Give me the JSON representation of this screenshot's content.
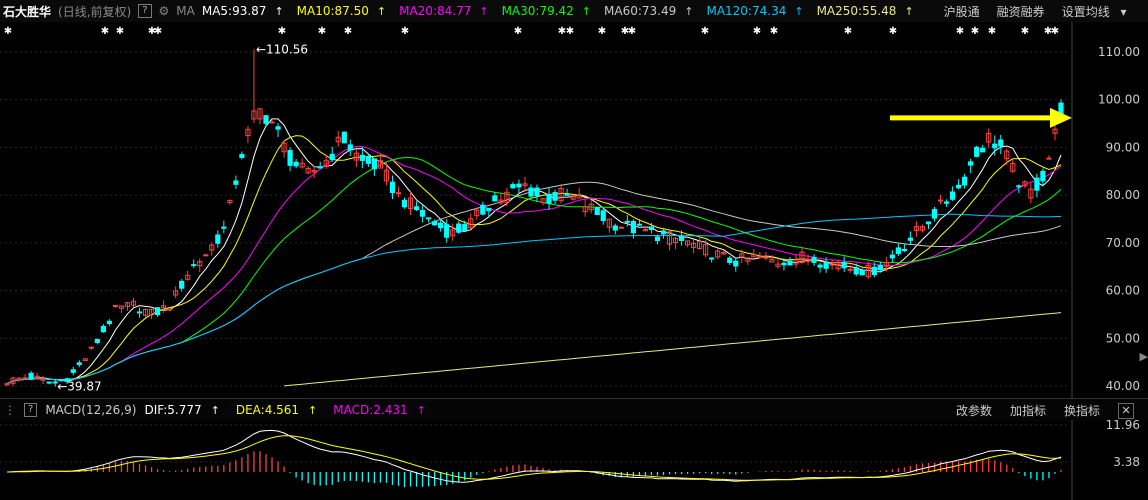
{
  "header": {
    "stock_name": "石大胜华",
    "period": "(日线,前复权)",
    "help": "?",
    "gear_glyph": "⚙",
    "ma_label": "MA",
    "ma_items": [
      {
        "label": "MA5:93.87",
        "color": "#ffffff"
      },
      {
        "label": "MA10:87.50",
        "color": "#ffff00"
      },
      {
        "label": "MA20:84.77",
        "color": "#ff00ff"
      },
      {
        "label": "MA30:79.42",
        "color": "#00ff00"
      },
      {
        "label": "MA60:73.49",
        "color": "#c8c8c8"
      },
      {
        "label": "MA120:74.34",
        "color": "#00c8ff"
      },
      {
        "label": "MA250:55.48",
        "color": "#e8e88a"
      }
    ],
    "up_arrow": "↑",
    "menu": [
      "沪股通",
      "融资融券",
      "设置均线"
    ],
    "dropdown_glyph": "▾"
  },
  "macd_header": {
    "title": "MACD(12,26,9)",
    "dif": "DIF:5.777",
    "dea": "DEA:4.561",
    "macd": "MACD:2.431",
    "buttons": [
      "改参数",
      "加指标",
      "换指标"
    ],
    "close": "✕"
  },
  "colors": {
    "up": "#ff4040",
    "down": "#00ffff",
    "arrow": "#ffff00",
    "ma5": "#ffffff",
    "ma10": "#ffff00",
    "ma20": "#ff00ff",
    "ma30": "#00ff00",
    "ma60": "#c8c8c8",
    "ma120": "#00c8ff",
    "ma250": "#e8e88a"
  },
  "chart_data": {
    "type": "candlestick",
    "y_ticks": [
      "110.00",
      "100.00",
      "90.00",
      "80.00",
      "70.00",
      "60.00",
      "50.00",
      "40.00"
    ],
    "ylim": [
      35,
      114
    ],
    "high_annotation": "←110.56",
    "low_annotation": "←39.87",
    "macd_y_ticks": [
      "11.96",
      "3.38"
    ]
  }
}
